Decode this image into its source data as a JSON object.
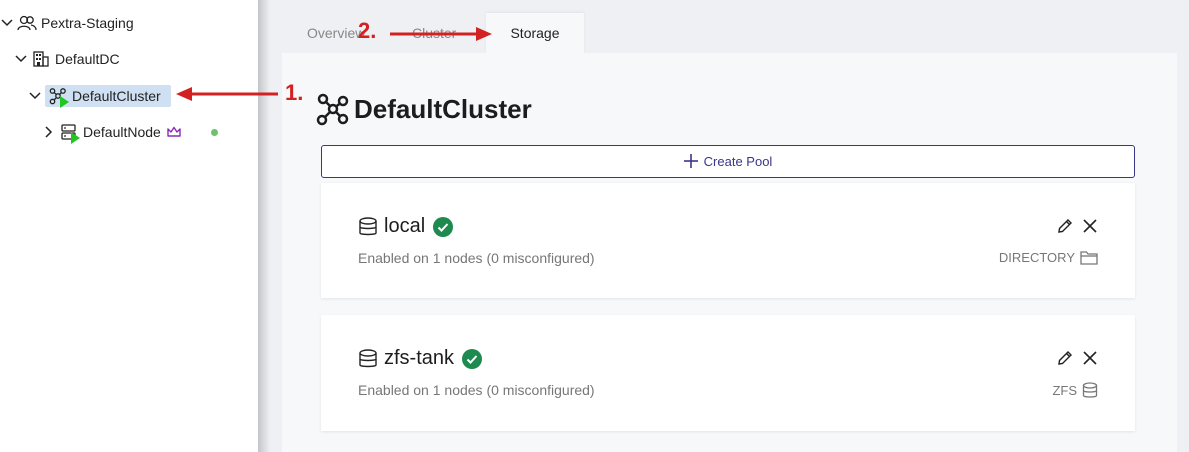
{
  "sidebar": {
    "items": [
      {
        "label": "Pextra-Staging"
      },
      {
        "label": "DefaultDC"
      },
      {
        "label": "DefaultCluster"
      },
      {
        "label": "DefaultNode"
      }
    ]
  },
  "tabs": [
    {
      "label": "Overview"
    },
    {
      "label": "Cluster"
    },
    {
      "label": "Storage"
    }
  ],
  "main": {
    "title": "DefaultCluster",
    "create_pool_label": "Create Pool",
    "pools": [
      {
        "name": "local",
        "subtitle": "Enabled on 1 nodes (0 misconfigured)",
        "type": "DIRECTORY",
        "type_icon": "folder-icon"
      },
      {
        "name": "zfs-tank",
        "subtitle": "Enabled on 1 nodes (0 misconfigured)",
        "type": "ZFS",
        "type_icon": "database-icon"
      }
    ]
  },
  "annotations": {
    "step1": "1.",
    "step2": "2."
  },
  "colors": {
    "accent": "#3a3588",
    "selected_row": "#cfe0f3",
    "status_ok": "#1e8a50",
    "annotation": "#d32020",
    "crown": "#8a2ab0",
    "running": "#22c522"
  }
}
